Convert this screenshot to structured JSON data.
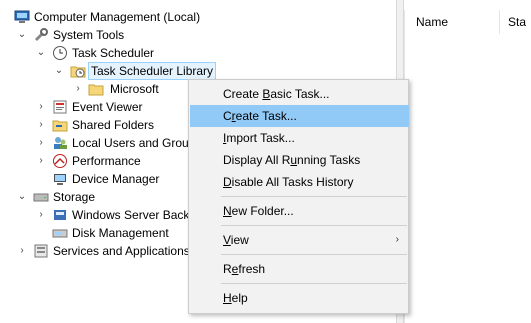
{
  "tree": {
    "items": [
      {
        "label": "Computer Management (Local)",
        "caret": "",
        "icon": "computer-management-icon"
      },
      {
        "label": "System Tools",
        "caret": "expanded",
        "icon": "tools-icon"
      },
      {
        "label": "Task Scheduler",
        "caret": "expanded",
        "icon": "clock-icon"
      },
      {
        "label": "Task Scheduler Library",
        "caret": "expanded",
        "icon": "folder-clock-icon",
        "selected": true
      },
      {
        "label": "Microsoft",
        "caret": "collapsed",
        "icon": "folder-icon"
      },
      {
        "label": "Event Viewer",
        "caret": "collapsed",
        "icon": "event-viewer-icon"
      },
      {
        "label": "Shared Folders",
        "caret": "collapsed",
        "icon": "shared-folders-icon"
      },
      {
        "label": "Local Users and Groups",
        "caret": "collapsed",
        "icon": "users-icon"
      },
      {
        "label": "Performance",
        "caret": "collapsed",
        "icon": "performance-icon"
      },
      {
        "label": "Device Manager",
        "caret": "",
        "icon": "device-manager-icon"
      },
      {
        "label": "Storage",
        "caret": "expanded",
        "icon": "storage-icon"
      },
      {
        "label": "Windows Server Backup",
        "caret": "collapsed",
        "icon": "backup-icon"
      },
      {
        "label": "Disk Management",
        "caret": "",
        "icon": "disk-icon"
      },
      {
        "label": "Services and Applications",
        "caret": "collapsed",
        "icon": "services-icon"
      }
    ]
  },
  "list": {
    "columns": [
      "Name",
      "Sta"
    ]
  },
  "menu": {
    "items": [
      {
        "pre": "Create ",
        "ul": "B",
        "post": "asic Task..."
      },
      {
        "pre": "C",
        "ul": "r",
        "post": "eate Task...",
        "hover": true
      },
      {
        "pre": "",
        "ul": "I",
        "post": "mport Task..."
      },
      {
        "pre": "Display All R",
        "ul": "u",
        "post": "nning Tasks"
      },
      {
        "pre": "",
        "ul": "D",
        "post": "isable All Tasks History"
      },
      {
        "pre": "",
        "ul": "N",
        "post": "ew Folder..."
      },
      {
        "pre": "",
        "ul": "V",
        "post": "iew",
        "submenu": true
      },
      {
        "pre": "R",
        "ul": "e",
        "post": "fresh"
      },
      {
        "pre": "",
        "ul": "H",
        "post": "elp"
      }
    ]
  }
}
